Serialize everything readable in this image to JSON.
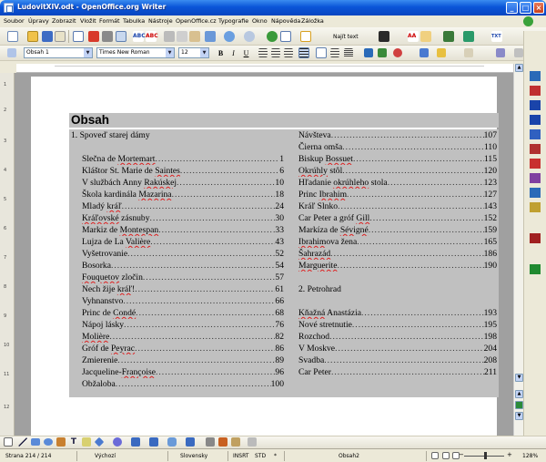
{
  "window": {
    "title": "LudovitXIV.odt - OpenOffice.org Writer"
  },
  "menu": [
    "Soubor",
    "Úpravy",
    "Zobrazit",
    "Vložit",
    "Formát",
    "Tabulka",
    "Nástroje",
    "OpenOffice.cz",
    "Typografie",
    "Okno",
    "Nápověda",
    "Záložka"
  ],
  "toolbar": {
    "find_label": "Najít text",
    "paragraph_style": "Obsah 1",
    "font_name": "Times New Roman",
    "font_size": "12",
    "bold": "B",
    "italic": "I",
    "underline": "U"
  },
  "ruler_left_numbers": [
    "1",
    "2",
    "3",
    "4",
    "5",
    "6",
    "7",
    "8",
    "9",
    "10",
    "11",
    "12"
  ],
  "document": {
    "heading": "Obsah",
    "column1": [
      {
        "text": "1. Spoveď starej dámy",
        "page": "",
        "kind": "header"
      },
      {
        "text": "",
        "page": "",
        "kind": "blank"
      },
      {
        "text": "Slečna de Mortemart",
        "page": "1",
        "kind": "entry"
      },
      {
        "text": "Kláštor St. Marie de Saintes",
        "page": "6",
        "kind": "entry"
      },
      {
        "text": "V službách Anny Rakúskej",
        "page": "10",
        "kind": "entry"
      },
      {
        "text": "Škola kardinála Mazarina",
        "page": "18",
        "kind": "entry"
      },
      {
        "text": "Mladý kráľ",
        "page": "24",
        "kind": "entry"
      },
      {
        "text": "Kráľovské zásnuby",
        "page": "30",
        "kind": "entry"
      },
      {
        "text": "Markiz de Montespan",
        "page": "33",
        "kind": "entry"
      },
      {
        "text": "Lujza de La Valière",
        "page": "43",
        "kind": "entry"
      },
      {
        "text": "Vyšetrovanie",
        "page": "52",
        "kind": "entry"
      },
      {
        "text": "Bosorka",
        "page": "54",
        "kind": "entry"
      },
      {
        "text": "Fouquetov zločin",
        "page": "57",
        "kind": "entry"
      },
      {
        "text": "Nech žije kráľ!",
        "page": "61",
        "kind": "entry"
      },
      {
        "text": "Vyhnanstvo",
        "page": "66",
        "kind": "entry"
      },
      {
        "text": "Princ de Condé",
        "page": "68",
        "kind": "entry"
      },
      {
        "text": "Nápoj lásky",
        "page": "76",
        "kind": "entry"
      },
      {
        "text": "Molière",
        "page": "82",
        "kind": "entry"
      },
      {
        "text": "Gróf de Peyrac",
        "page": "86",
        "kind": "entry"
      },
      {
        "text": "Zmierenie",
        "page": "89",
        "kind": "entry"
      },
      {
        "text": "Jacqueline-Françoise",
        "page": "96",
        "kind": "entry"
      },
      {
        "text": "Obžaloba",
        "page": "100",
        "kind": "entry"
      }
    ],
    "column2": [
      {
        "text": "Návšteva",
        "page": "107",
        "kind": "entry"
      },
      {
        "text": "Čierna omša",
        "page": "110",
        "kind": "entry"
      },
      {
        "text": "Biskup Bossuet",
        "page": "115",
        "kind": "entry"
      },
      {
        "text": "Okrúhly stôl",
        "page": "120",
        "kind": "entry"
      },
      {
        "text": "Hľadanie okrúhleho stola",
        "page": "123",
        "kind": "entry"
      },
      {
        "text": "Princ Ibrahim",
        "page": "127",
        "kind": "entry"
      },
      {
        "text": "Kráľ Slnko",
        "page": "143",
        "kind": "entry"
      },
      {
        "text": "Car Peter a gróf Gill",
        "page": "152",
        "kind": "entry"
      },
      {
        "text": "Markíza de Sévigné",
        "page": "159",
        "kind": "entry"
      },
      {
        "text": "Ibrahimova žena",
        "page": "165",
        "kind": "entry"
      },
      {
        "text": "Šahrazád",
        "page": "186",
        "kind": "entry"
      },
      {
        "text": "Marguerite",
        "page": "190",
        "kind": "entry"
      },
      {
        "text": "",
        "page": "",
        "kind": "blank"
      },
      {
        "text": "2. Petrohrad",
        "page": "",
        "kind": "header"
      },
      {
        "text": "",
        "page": "",
        "kind": "blank"
      },
      {
        "text": "Kňažná Anastázia",
        "page": "193",
        "kind": "entry"
      },
      {
        "text": "Nové stretnutie",
        "page": "195",
        "kind": "entry"
      },
      {
        "text": "Rozchod",
        "page": "198",
        "kind": "entry"
      },
      {
        "text": "V Moskve",
        "page": "204",
        "kind": "entry"
      },
      {
        "text": "Svadba",
        "page": "208",
        "kind": "entry"
      },
      {
        "text": "Car Peter",
        "page": "211",
        "kind": "entry"
      }
    ]
  },
  "status": {
    "page": "Strana 214 / 214",
    "page_style": "Výchozí",
    "language": "Slovensky",
    "insert_mode": "INSRT",
    "selection_mode": "STD",
    "star": "*",
    "section": "Obsah2",
    "zoom": "128%",
    "zoom_fraction": 0.52
  },
  "colors": {
    "toc_shading": "#c0c0c0",
    "title_bar": "#0a55d8",
    "spell_underline": "#d22222"
  }
}
